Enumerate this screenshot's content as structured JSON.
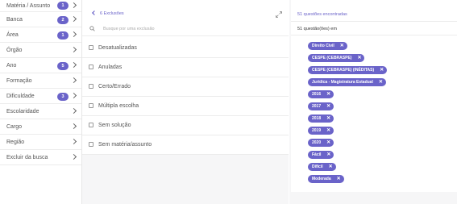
{
  "sidebar": {
    "items": [
      {
        "label": "Matéria / Assunto",
        "badge": "1"
      },
      {
        "label": "Banca",
        "badge": "2"
      },
      {
        "label": "Área",
        "badge": "1"
      },
      {
        "label": "Órgão",
        "badge": ""
      },
      {
        "label": "Ano",
        "badge": "5"
      },
      {
        "label": "Formação",
        "badge": ""
      },
      {
        "label": "Dificuldade",
        "badge": "3"
      },
      {
        "label": "Escolaridade",
        "badge": ""
      },
      {
        "label": "Cargo",
        "badge": ""
      },
      {
        "label": "Região",
        "badge": ""
      },
      {
        "label": "Excluir da busca",
        "badge": ""
      }
    ]
  },
  "middle": {
    "title": "6 Exclusões",
    "search_placeholder": "Busque por uma exclusão",
    "options": [
      {
        "label": "Desatualizadas"
      },
      {
        "label": "Anuladas"
      },
      {
        "label": "Certo/Errado"
      },
      {
        "label": "Múltipla escolha"
      },
      {
        "label": "Sem solução"
      },
      {
        "label": "Sem matéria/assunto"
      }
    ]
  },
  "right": {
    "found_text": "51 questões encontradas",
    "count_text": "51 questão(ões) em",
    "chips": [
      {
        "label": "Direito Civil"
      },
      {
        "label": "CESPE (CEBRASPE)"
      },
      {
        "label": "CESPE (CEBRASPE) (INÉDITAS)"
      },
      {
        "label": "Jurídica - Magistratura Estadual"
      },
      {
        "label": "2016"
      },
      {
        "label": "2017"
      },
      {
        "label": "2018"
      },
      {
        "label": "2019"
      },
      {
        "label": "2020"
      },
      {
        "label": "Fácil"
      },
      {
        "label": "Difícil"
      },
      {
        "label": "Moderada"
      }
    ]
  },
  "colors": {
    "accent": "#6a63c9"
  }
}
